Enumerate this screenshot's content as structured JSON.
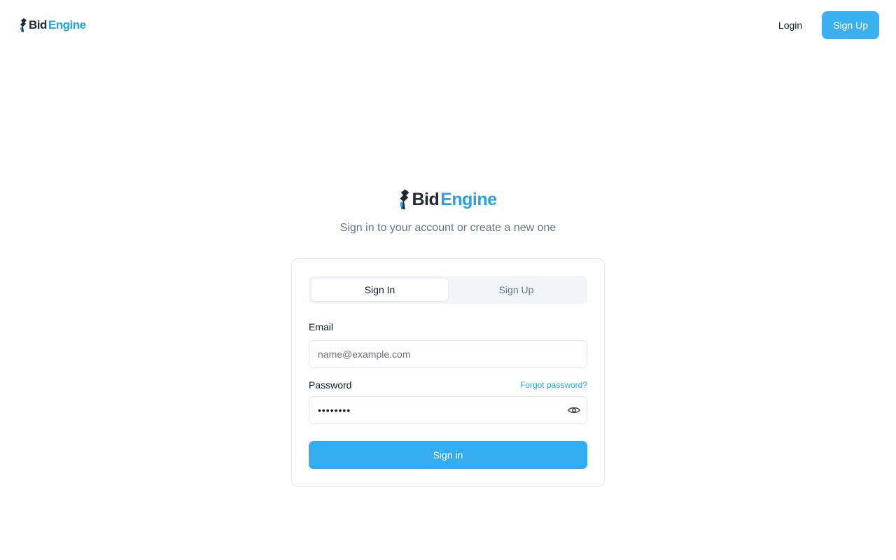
{
  "header": {
    "logo": {
      "part1": "Bid",
      "part2": "Engine"
    },
    "login_label": "Login",
    "signup_label": "Sign Up"
  },
  "hero": {
    "logo": {
      "part1": "Bid",
      "part2": "Engine"
    },
    "subtitle": "Sign in to your account or create a new one"
  },
  "auth_card": {
    "tabs": [
      {
        "label": "Sign In",
        "active": true
      },
      {
        "label": "Sign Up",
        "active": false
      }
    ],
    "email": {
      "label": "Email",
      "value": "",
      "placeholder": "name@example.com"
    },
    "password": {
      "label": "Password",
      "value": "••••••••",
      "placeholder": ""
    },
    "forgot_label": "Forgot password?",
    "submit_label": "Sign in"
  },
  "icons": {
    "logo_mark": "gavel-flame-icon",
    "password_toggle": "eye-icon"
  },
  "colors": {
    "brand_blue": "#2b9fe8",
    "button_blue": "#33adf0",
    "brand_dark": "#1f2937"
  }
}
